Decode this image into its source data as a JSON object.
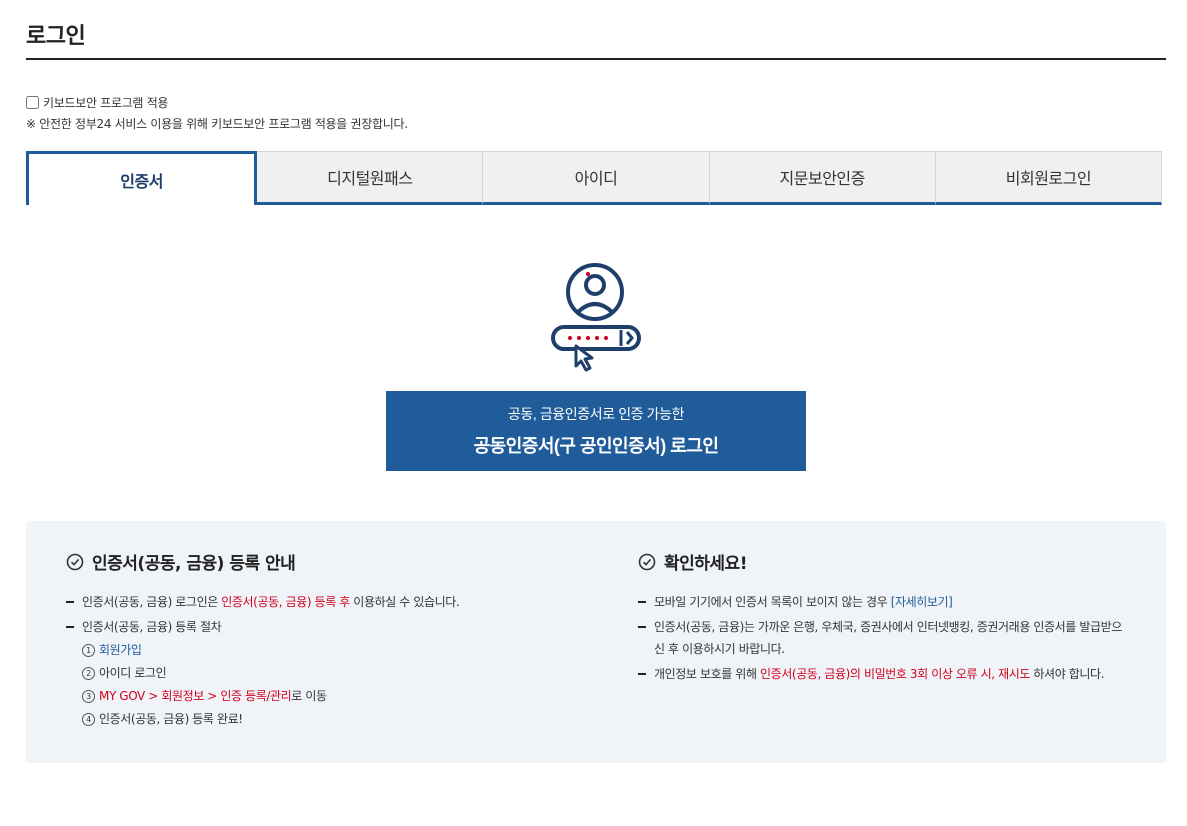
{
  "page": {
    "title": "로그인"
  },
  "keyboard": {
    "checkbox_label": "키보드보안 프로그램 적용",
    "note": "※ 안전한 정부24 서비스 이용을 위해 키보드보안 프로그램 적용을 권장합니다."
  },
  "tabs": [
    {
      "label": "인증서",
      "active": true
    },
    {
      "label": "디지털원패스",
      "active": false
    },
    {
      "label": "아이디",
      "active": false
    },
    {
      "label": "지문보안인증",
      "active": false
    },
    {
      "label": "비회원로그인",
      "active": false
    }
  ],
  "login_button": {
    "sub": "공동, 금융인증서로 인증 가능한",
    "main": "공동인증서(구 공인인증서) 로그인"
  },
  "guide": {
    "heading": "인증서(공동, 금융) 등록 안내",
    "item1_prefix": "인증서(공동, 금융) 로그인은 ",
    "item1_highlight": "인증서(공동, 금융) 등록 후",
    "item1_suffix": " 이용하실 수 있습니다.",
    "item2": "인증서(공동, 금융) 등록 절차",
    "steps": [
      {
        "num": "1",
        "text": "회원가입"
      },
      {
        "num": "2",
        "text": "아이디 로그인"
      },
      {
        "num": "3",
        "highlight": "MY GOV > 회원정보 > 인증 등록/관리",
        "suffix": "로 이동"
      },
      {
        "num": "4",
        "text": "인증서(공동, 금융) 등록 완료!"
      }
    ]
  },
  "confirm": {
    "heading": "확인하세요!",
    "item1_text": "모바일 기기에서 인증서 목록이 보이지 않는 경우 ",
    "item1_link": "[자세히보기]",
    "item2": "인증서(공동, 금융)는 가까운 은행, 우체국, 증권사에서 인터넷뱅킹, 증권거래용 인증서를 발급받으신 후 이용하시기 바랍니다.",
    "item3_prefix": "개인정보 보호를 위해 ",
    "item3_highlight": "인증서(공동, 금융)의 비밀번호 3회 이상 오류 시, 재시도",
    "item3_suffix": " 하셔야 합니다."
  },
  "colors": {
    "primary": "#1f5c99",
    "highlight": "#d0021b",
    "panel": "#f0f4f8"
  }
}
